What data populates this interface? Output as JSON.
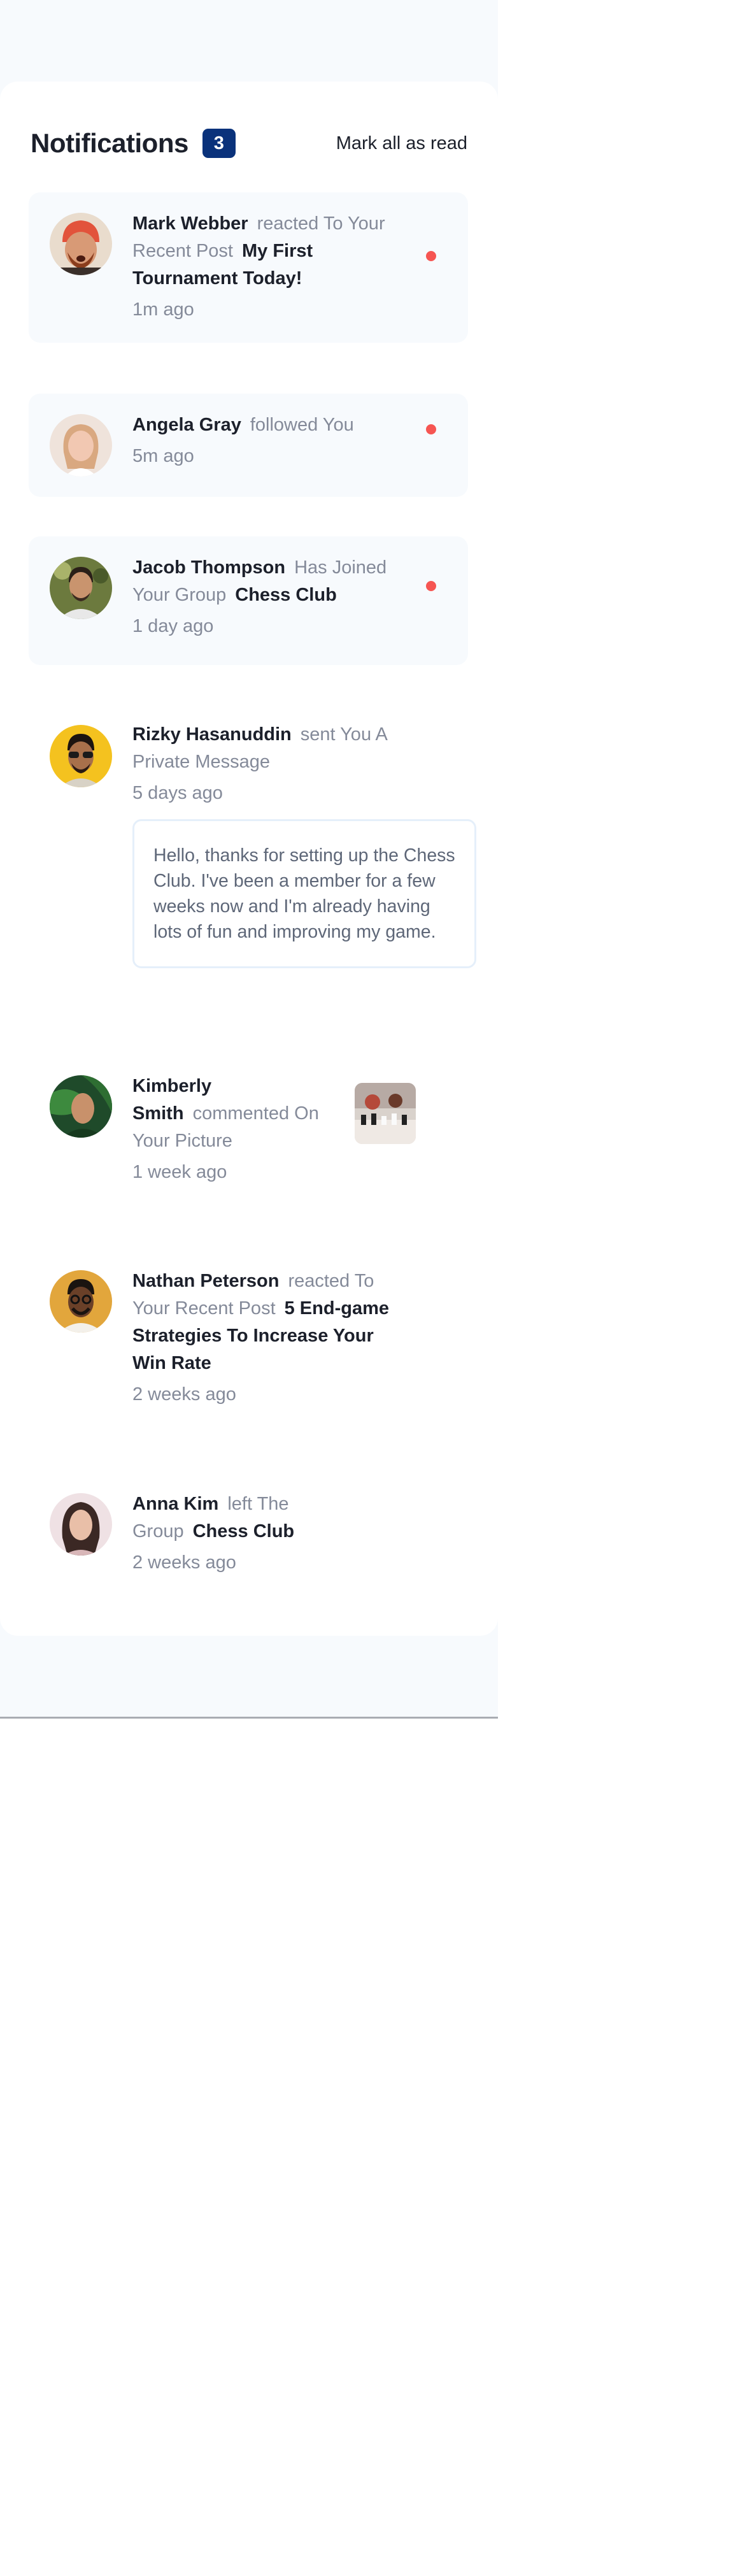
{
  "header": {
    "title": "Notifications",
    "unread_count": "3",
    "mark_all_label": "Mark all as read"
  },
  "notifications": [
    {
      "name": "Mark Webber",
      "action": "reacted To Your Recent Post",
      "target": "My First Tournament Today!",
      "time": "1m ago",
      "unread": true,
      "avatar_icon": "avatar-mark-webber"
    },
    {
      "name": "Angela Gray",
      "action": "followed You",
      "target": "",
      "time": "5m ago",
      "unread": true,
      "avatar_icon": "avatar-angela-gray"
    },
    {
      "name": "Jacob Thompson",
      "action": "Has Joined Your Group",
      "target": "Chess Club",
      "time": "1 day ago",
      "unread": true,
      "avatar_icon": "avatar-jacob-thompson"
    },
    {
      "name": "Rizky Hasanuddin",
      "action": "sent You A Private Message",
      "target": "",
      "time": "5 days ago",
      "unread": false,
      "message": "Hello, thanks for setting up the Chess Club. I've been a member for a few weeks now and I'm already having lots of fun and improving my game.",
      "avatar_icon": "avatar-rizky-hasanuddin"
    },
    {
      "name": "Kimberly Smith",
      "action": "commented On Your Picture",
      "target": "",
      "time": "1 week ago",
      "unread": false,
      "thumbnail": "chess-picture",
      "avatar_icon": "avatar-kimberly-smith"
    },
    {
      "name": "Nathan Peterson",
      "action": "reacted To Your Recent Post",
      "target": "5 End-game Strategies To Increase Your Win Rate",
      "time": "2 weeks ago",
      "unread": false,
      "avatar_icon": "avatar-nathan-peterson"
    },
    {
      "name": "Anna Kim",
      "action": "left The Group",
      "target": "Chess Club",
      "time": "2 weeks ago",
      "unread": false,
      "avatar_icon": "avatar-anna-kim"
    }
  ],
  "colors": {
    "accent": "#0a327b",
    "unread_dot": "#f65552",
    "unread_bg": "#f7fafd",
    "text_dark": "#1c202b",
    "text_muted": "#848a99"
  }
}
